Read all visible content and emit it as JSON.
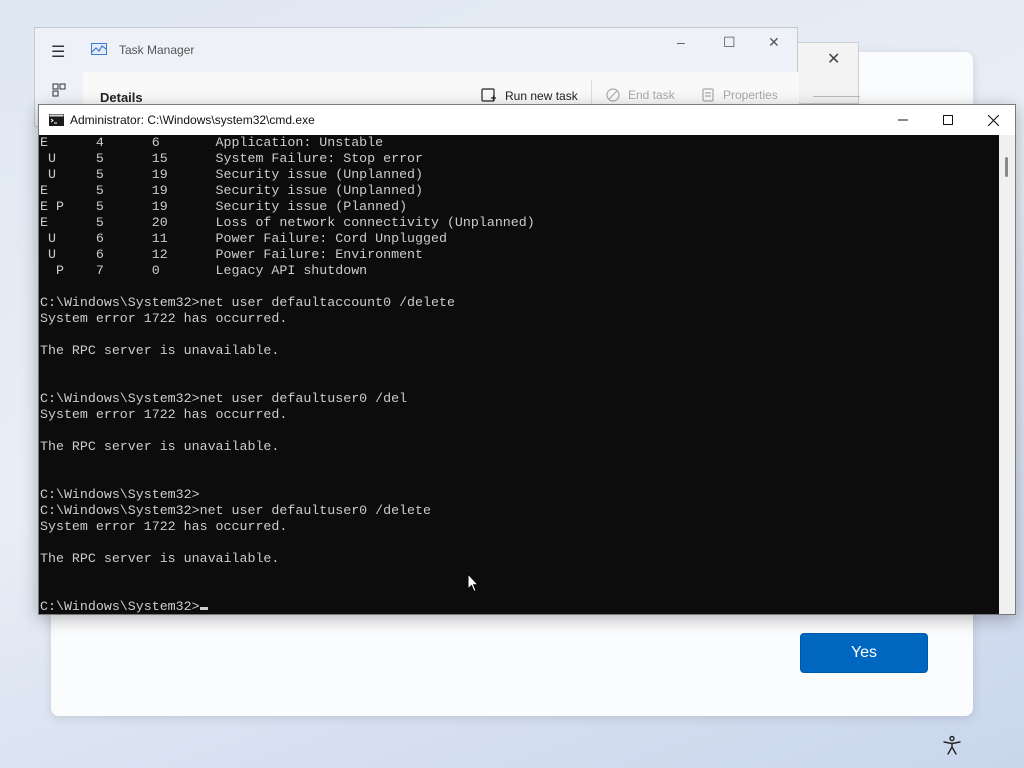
{
  "oobe": {
    "yes_label": "Yes",
    "accessibility_icon": "accessibility-icon",
    "accent": "#0067c0"
  },
  "task_manager": {
    "title": "Task Manager",
    "section": "Details",
    "toolbar": {
      "run_new_task": "Run new task",
      "end_task": "End task",
      "properties": "Properties"
    },
    "icons": [
      "hamburger-menu-icon",
      "task-manager-app-icon",
      "processes-icon",
      "run-task-icon",
      "end-task-icon",
      "properties-icon"
    ]
  },
  "cmd": {
    "title": "Administrator: C:\\Windows\\system32\\cmd.exe",
    "background": "#0c0c0c",
    "foreground": "#cccccc",
    "lines": [
      "E      4      6       Application: Unstable",
      " U     5      15      System Failure: Stop error",
      " U     5      19      Security issue (Unplanned)",
      "E      5      19      Security issue (Unplanned)",
      "E P    5      19      Security issue (Planned)",
      "E      5      20      Loss of network connectivity (Unplanned)",
      " U     6      11      Power Failure: Cord Unplugged",
      " U     6      12      Power Failure: Environment",
      "  P    7      0       Legacy API shutdown",
      "",
      "C:\\Windows\\System32>net user defaultaccount0 /delete",
      "System error 1722 has occurred.",
      "",
      "The RPC server is unavailable.",
      "",
      "",
      "C:\\Windows\\System32>net user defaultuser0 /del",
      "System error 1722 has occurred.",
      "",
      "The RPC server is unavailable.",
      "",
      "",
      "C:\\Windows\\System32>",
      "C:\\Windows\\System32>net user defaultuser0 /delete",
      "System error 1722 has occurred.",
      "",
      "The RPC server is unavailable.",
      "",
      "",
      "C:\\Windows\\System32>"
    ]
  }
}
